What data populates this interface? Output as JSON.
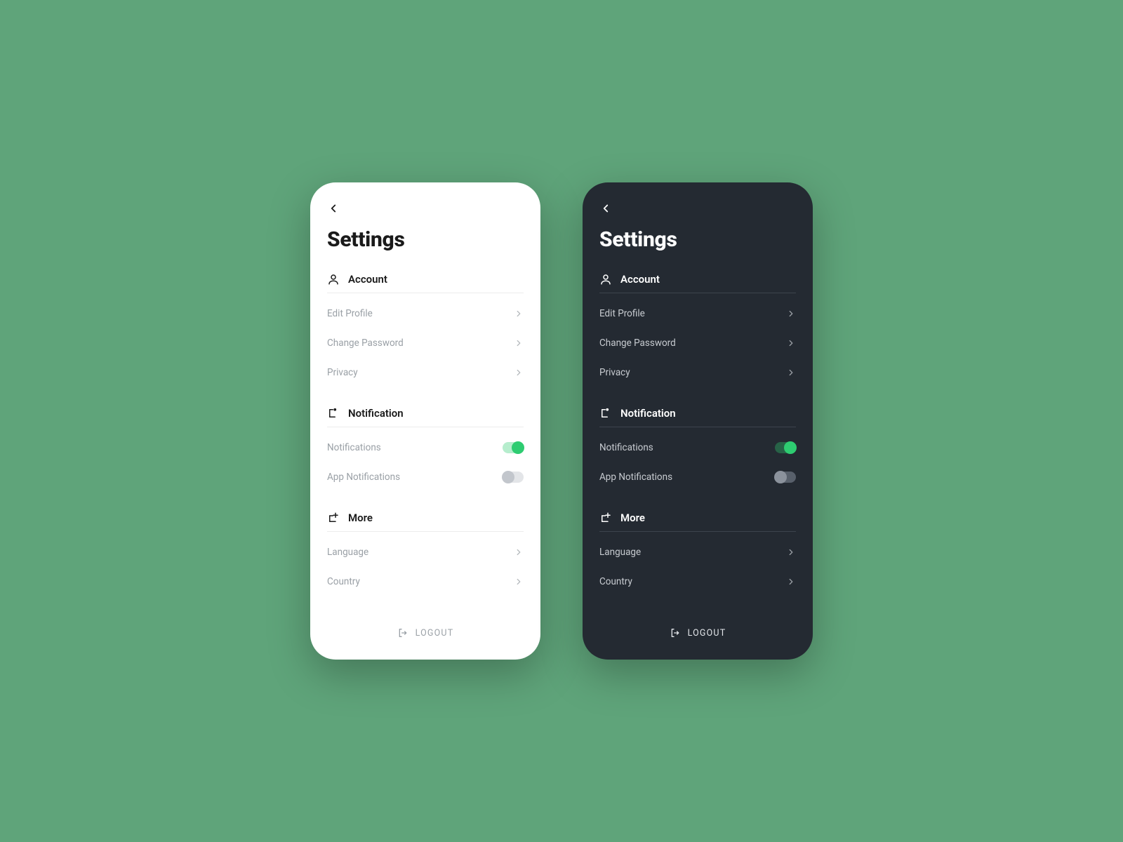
{
  "title": "Settings",
  "sections": {
    "account": {
      "label": "Account",
      "items": [
        {
          "label": "Edit Profile"
        },
        {
          "label": "Change Password"
        },
        {
          "label": "Privacy"
        }
      ]
    },
    "notification": {
      "label": "Notification",
      "items": [
        {
          "label": "Notifications",
          "toggle": true,
          "on": true
        },
        {
          "label": "App Notifications",
          "toggle": true,
          "on": false
        }
      ]
    },
    "more": {
      "label": "More",
      "items": [
        {
          "label": "Language"
        },
        {
          "label": "Country"
        }
      ]
    }
  },
  "logout": "LOGOUT"
}
